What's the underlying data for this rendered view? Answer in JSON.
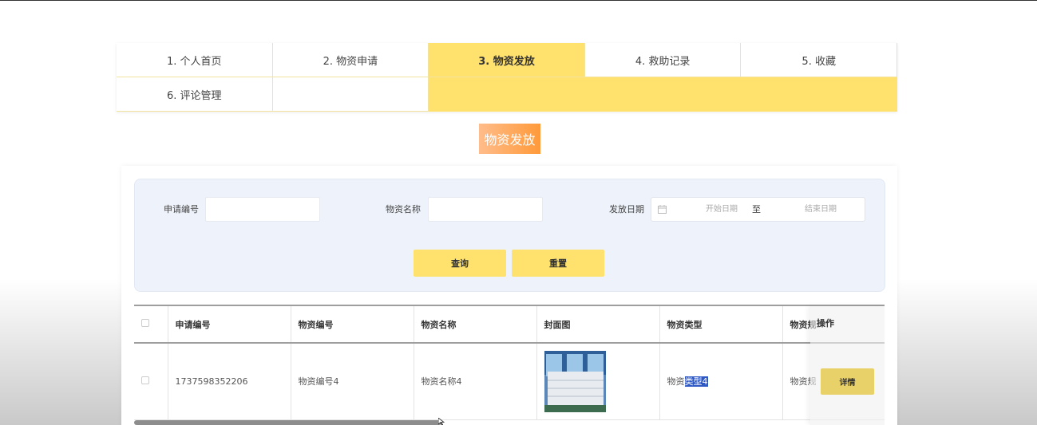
{
  "nav": {
    "tabs": [
      {
        "label": "1. 个人首页"
      },
      {
        "label": "2. 物资申请"
      },
      {
        "label": "3. 物资发放"
      },
      {
        "label": "4. 救助记录"
      },
      {
        "label": "5. 收藏"
      },
      {
        "label": "6. 评论管理"
      }
    ],
    "active_index": 2,
    "active_color": "#ffe16d"
  },
  "page_title": "物资发放",
  "search": {
    "apply_no_label": "申请编号",
    "apply_no_value": "",
    "material_name_label": "物资名称",
    "material_name_value": "",
    "date_label": "发放日期",
    "date_start_placeholder": "开始日期",
    "date_separator": "至",
    "date_end_placeholder": "结束日期",
    "query_button": "查询",
    "reset_button": "重置"
  },
  "table": {
    "headers": [
      "申请编号",
      "物资编号",
      "物资名称",
      "封面图",
      "物资类型",
      "物资规"
    ],
    "operation_header": "操作",
    "rows": [
      {
        "apply_no": "1737598352206",
        "material_no": "物资编号4",
        "material_name": "物资名称4",
        "cover": "cover-image",
        "type_prefix": "物资",
        "type_selected": "类型4",
        "spec": "物资规",
        "detail_button": "详情"
      }
    ]
  },
  "colors": {
    "accent": "#ffe16d",
    "title_gradient_start": "#ffbc8a",
    "title_gradient_end": "#ff9a3a",
    "selection": "#2e59c4"
  }
}
